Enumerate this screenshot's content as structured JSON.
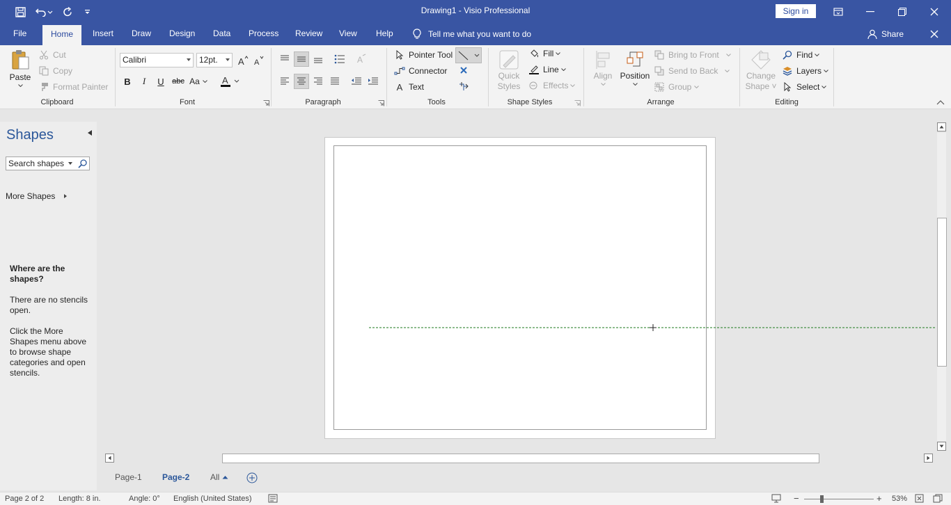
{
  "titlebar": {
    "title": "Drawing1  -  Visio Professional",
    "sign_in": "Sign in",
    "qat": [
      "save-icon",
      "undo-icon",
      "redo-icon",
      "customize-icon"
    ]
  },
  "tabs": [
    {
      "label": "File"
    },
    {
      "label": "Home",
      "active": true
    },
    {
      "label": "Insert"
    },
    {
      "label": "Draw"
    },
    {
      "label": "Design"
    },
    {
      "label": "Data"
    },
    {
      "label": "Process"
    },
    {
      "label": "Review"
    },
    {
      "label": "View"
    },
    {
      "label": "Help"
    }
  ],
  "tellme": "Tell me what you want to do",
  "share": "Share",
  "ribbon": {
    "clipboard": {
      "label": "Clipboard",
      "paste": "Paste",
      "cut": "Cut",
      "copy": "Copy",
      "format_painter": "Format Painter"
    },
    "font": {
      "label": "Font",
      "family": "Calibri",
      "size": "12pt."
    },
    "paragraph": {
      "label": "Paragraph"
    },
    "tools": {
      "label": "Tools",
      "pointer": "Pointer Tool",
      "connector": "Connector",
      "text": "Text"
    },
    "shape_styles": {
      "label": "Shape Styles",
      "quick1": "Quick",
      "quick2": "Styles",
      "fill": "Fill",
      "line": "Line",
      "effects": "Effects"
    },
    "arrange": {
      "label": "Arrange",
      "align": "Align",
      "position": "Position",
      "bring_front": "Bring to Front",
      "send_back": "Send to Back",
      "group": "Group"
    },
    "editing": {
      "label": "Editing",
      "change1": "Change",
      "change2": "Shape",
      "find": "Find",
      "layers": "Layers",
      "select": "Select"
    }
  },
  "shapes_pane": {
    "title": "Shapes",
    "search_placeholder": "Search shapes",
    "more_shapes": "More Shapes",
    "where_title": "Where are the shapes?",
    "where_p1": "There are no stencils open.",
    "where_p2": "Click the More Shapes menu above to browse shape categories and open stencils."
  },
  "page_tabs": [
    {
      "label": "Page-1"
    },
    {
      "label": "Page-2",
      "active": true
    },
    {
      "label": "All"
    }
  ],
  "status": {
    "page": "Page 2 of 2",
    "length": "Length: 8 in.",
    "angle": "Angle: 0°",
    "language": "English (United States)",
    "zoom": "53%",
    "zoom_value": 0.53
  },
  "colors": {
    "brand": "#3955a3",
    "accent": "#2b579a",
    "guide": "#1e7a1e"
  }
}
